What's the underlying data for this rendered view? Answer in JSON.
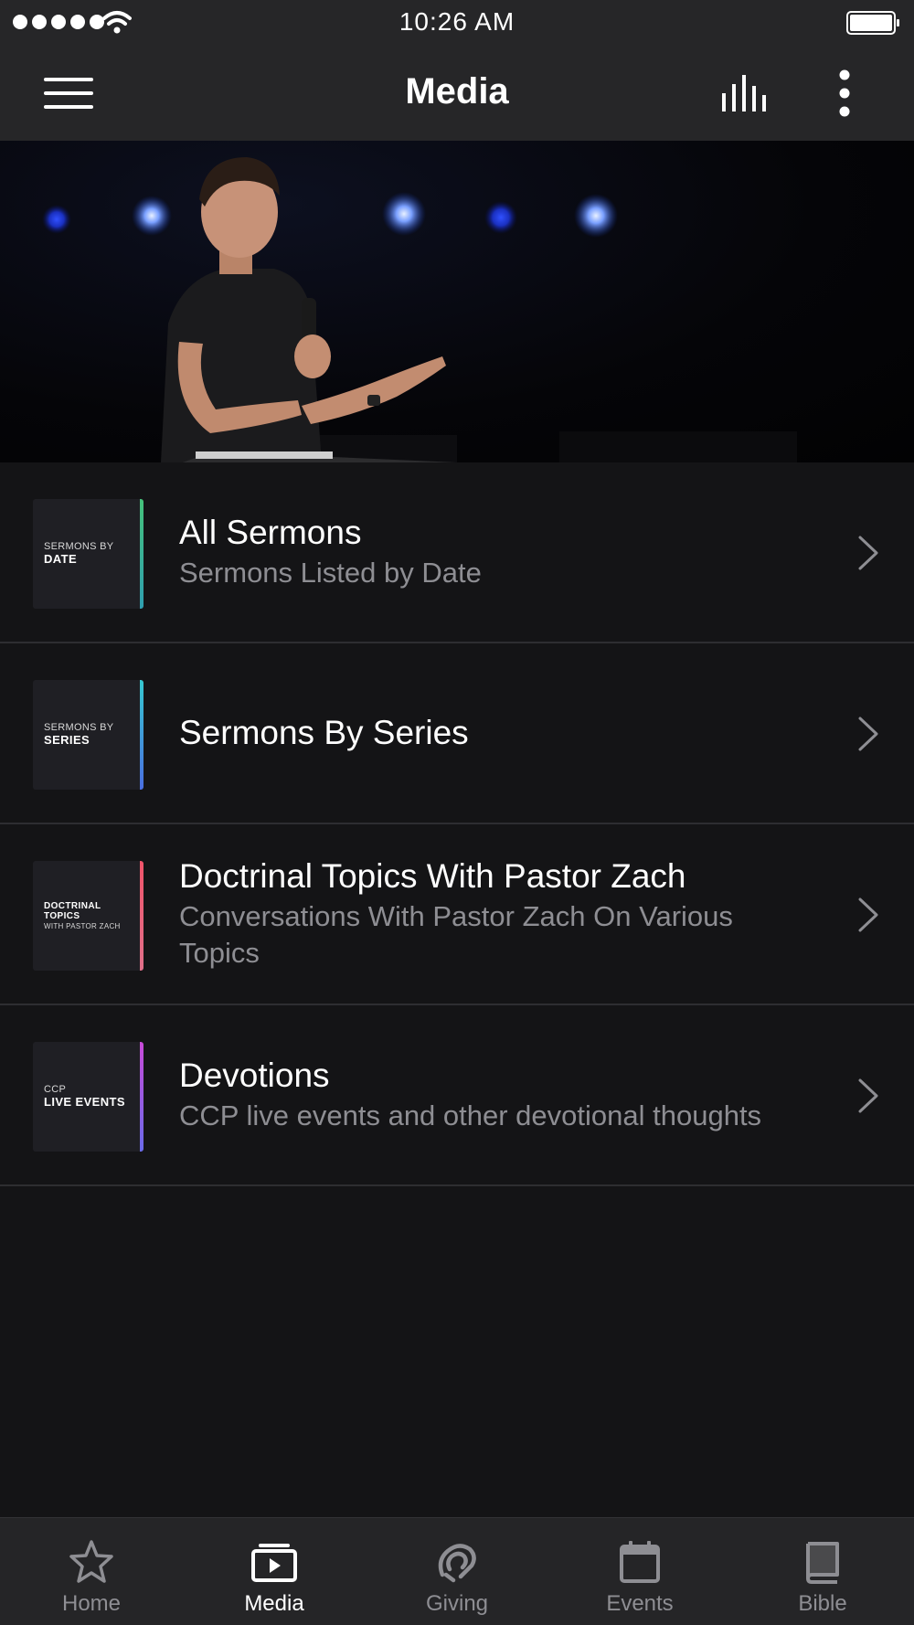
{
  "status_bar": {
    "time": "10:26 AM",
    "signal_icon": "signal-dots-icon",
    "wifi_icon": "wifi-icon",
    "battery_icon": "battery-icon"
  },
  "header": {
    "title": "Media",
    "menu_icon": "hamburger-menu-icon",
    "audio_icon": "audio-bars-icon",
    "more_icon": "more-vertical-icon"
  },
  "hero": {
    "image": "pastor-speaking-on-stage"
  },
  "media_list": [
    {
      "thumb_small": "SERMONS BY",
      "thumb_big": "DATE",
      "accent": "#3fbf7f",
      "title": "All Sermons",
      "subtitle": "Sermons Listed by Date"
    },
    {
      "thumb_small": "SERMONS BY",
      "thumb_big": "SERIES",
      "accent": "#36c4d8",
      "title": "Sermons By Series",
      "subtitle": ""
    },
    {
      "thumb_small": "WITH PASTOR ZACH",
      "thumb_big": "DOCTRINAL TOPICS",
      "accent": "#ee5a6f",
      "title": "Doctrinal Topics With Pastor Zach",
      "subtitle": "Conversations With Pastor Zach On Various Topics"
    },
    {
      "thumb_small": "CCP",
      "thumb_big": "LIVE EVENTS",
      "accent": "#b84fd8",
      "title": "Devotions",
      "subtitle": "CCP live events and other devotional thoughts"
    }
  ],
  "tab_bar": {
    "tabs": [
      {
        "label": "Home",
        "icon": "star-icon",
        "active": false
      },
      {
        "label": "Media",
        "icon": "media-play-icon",
        "active": true
      },
      {
        "label": "Giving",
        "icon": "giving-icon",
        "active": false
      },
      {
        "label": "Events",
        "icon": "calendar-icon",
        "active": false
      },
      {
        "label": "Bible",
        "icon": "book-icon",
        "active": false
      }
    ]
  },
  "colors": {
    "background": "#141416",
    "bar_background": "#262628",
    "subtitle_gray": "#8e8e93",
    "separator": "#2e2e31"
  }
}
